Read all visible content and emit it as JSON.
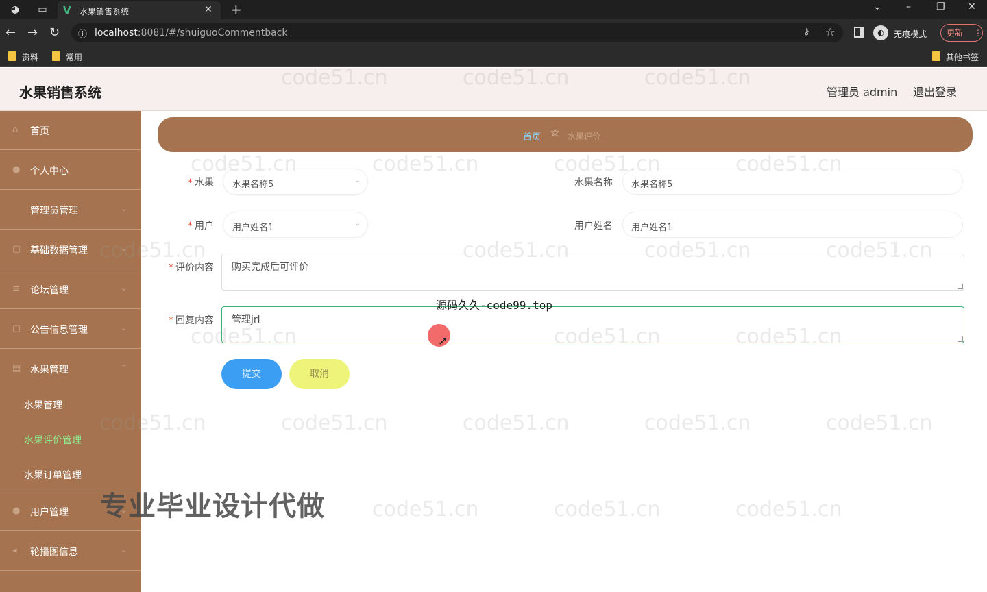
{
  "browser": {
    "tab_title": "水果销售系统",
    "url_host": "localhost",
    "url_rest": ":8081/#/shuiguoCommentback",
    "profile_label": "无痕模式",
    "update_label": "更新",
    "bookmarks": [
      "资料",
      "常用"
    ],
    "other_bookmarks": "其他书签"
  },
  "header": {
    "title": "水果销售系统",
    "user_label": "管理员 admin",
    "logout_label": "退出登录"
  },
  "sidebar": {
    "items": [
      {
        "label": "首页",
        "icon": "home-icon"
      },
      {
        "label": "个人中心",
        "icon": "user-icon"
      },
      {
        "label": "管理员管理",
        "icon": ""
      },
      {
        "label": "基础数据管理",
        "icon": "data-icon"
      },
      {
        "label": "论坛管理",
        "icon": "list-icon"
      },
      {
        "label": "公告信息管理",
        "icon": "notice-icon"
      },
      {
        "label": "水果管理",
        "icon": "grid-icon"
      }
    ],
    "sub_items": [
      {
        "label": "水果管理"
      },
      {
        "label": "水果评价管理",
        "active": true
      },
      {
        "label": "水果订单管理"
      }
    ],
    "bottom_items": [
      {
        "label": "用户管理",
        "icon": "user-icon"
      },
      {
        "label": "轮播图信息",
        "icon": "image-icon"
      }
    ]
  },
  "breadcrumb": {
    "home": "首页",
    "current": "水果评价"
  },
  "form": {
    "fruit_label": "水果",
    "fruit_value": "水果名称5",
    "fruit_name_label": "水果名称",
    "fruit_name_value": "水果名称5",
    "user_label": "用户",
    "user_value": "用户姓名1",
    "user_name_label": "用户姓名",
    "user_name_value": "用户姓名1",
    "comment_label": "评价内容",
    "comment_value": "购买完成后可评价",
    "reply_label": "回复内容",
    "reply_value": "管理jrl",
    "submit_label": "提交",
    "cancel_label": "取消"
  },
  "overlay": {
    "source_text": "源码久久-code99.top",
    "promo_text": "专业毕业设计代做",
    "watermark": "code51.cn"
  },
  "colors": {
    "sidebar": "#a5734f",
    "submit": "#3c9ef2",
    "cancel": "#eef37a",
    "active_sub": "#90ee90"
  }
}
